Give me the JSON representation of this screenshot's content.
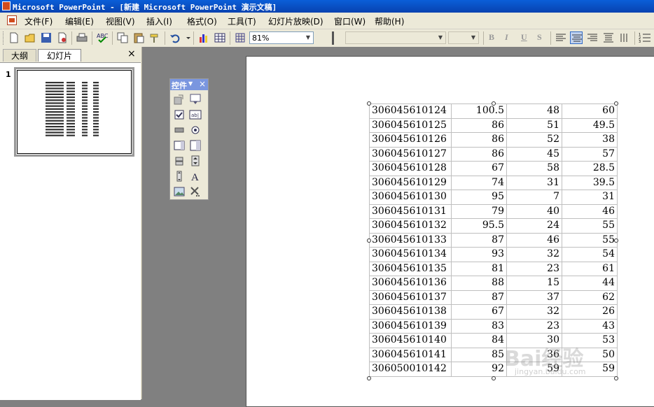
{
  "window": {
    "title": "Microsoft PowerPoint - [新建 Microsoft PowerPoint 演示文稿]"
  },
  "menu": [
    "文件(F)",
    "编辑(E)",
    "视图(V)",
    "插入(I)",
    "格式(O)",
    "工具(T)",
    "幻灯片放映(D)",
    "窗口(W)",
    "帮助(H)"
  ],
  "toolbar": {
    "zoom": "81%",
    "font_name": "",
    "font_size": "",
    "bold": "B",
    "italic": "I",
    "underline": "U",
    "shadow": "S"
  },
  "left_panel": {
    "tabs": [
      "大纲",
      "幻灯片"
    ],
    "active_tab": "幻灯片",
    "close": "×",
    "slide_number": "1"
  },
  "toolbox": {
    "title": "控件",
    "close": "×"
  },
  "table": {
    "rows": [
      [
        "306045610124",
        "100.5",
        "48",
        "60"
      ],
      [
        "306045610125",
        "86",
        "51",
        "49.5"
      ],
      [
        "306045610126",
        "86",
        "52",
        "38"
      ],
      [
        "306045610127",
        "86",
        "45",
        "57"
      ],
      [
        "306045610128",
        "67",
        "58",
        "28.5"
      ],
      [
        "306045610129",
        "74",
        "31",
        "39.5"
      ],
      [
        "306045610130",
        "95",
        "7",
        "31"
      ],
      [
        "306045610131",
        "79",
        "40",
        "46"
      ],
      [
        "306045610132",
        "95.5",
        "24",
        "55"
      ],
      [
        "306045610133",
        "87",
        "46",
        "55"
      ],
      [
        "306045610134",
        "93",
        "32",
        "54"
      ],
      [
        "306045610135",
        "81",
        "23",
        "61"
      ],
      [
        "306045610136",
        "88",
        "15",
        "44"
      ],
      [
        "306045610137",
        "87",
        "37",
        "62"
      ],
      [
        "306045610138",
        "67",
        "32",
        "26"
      ],
      [
        "306045610139",
        "83",
        "23",
        "43"
      ],
      [
        "306045610140",
        "84",
        "30",
        "53"
      ],
      [
        "306045610141",
        "85",
        "36",
        "50"
      ],
      [
        "306050010142",
        "92",
        "59",
        "59"
      ]
    ]
  },
  "watermark": {
    "text": "Bai经验",
    "url": "jingyan.baidu.com"
  }
}
